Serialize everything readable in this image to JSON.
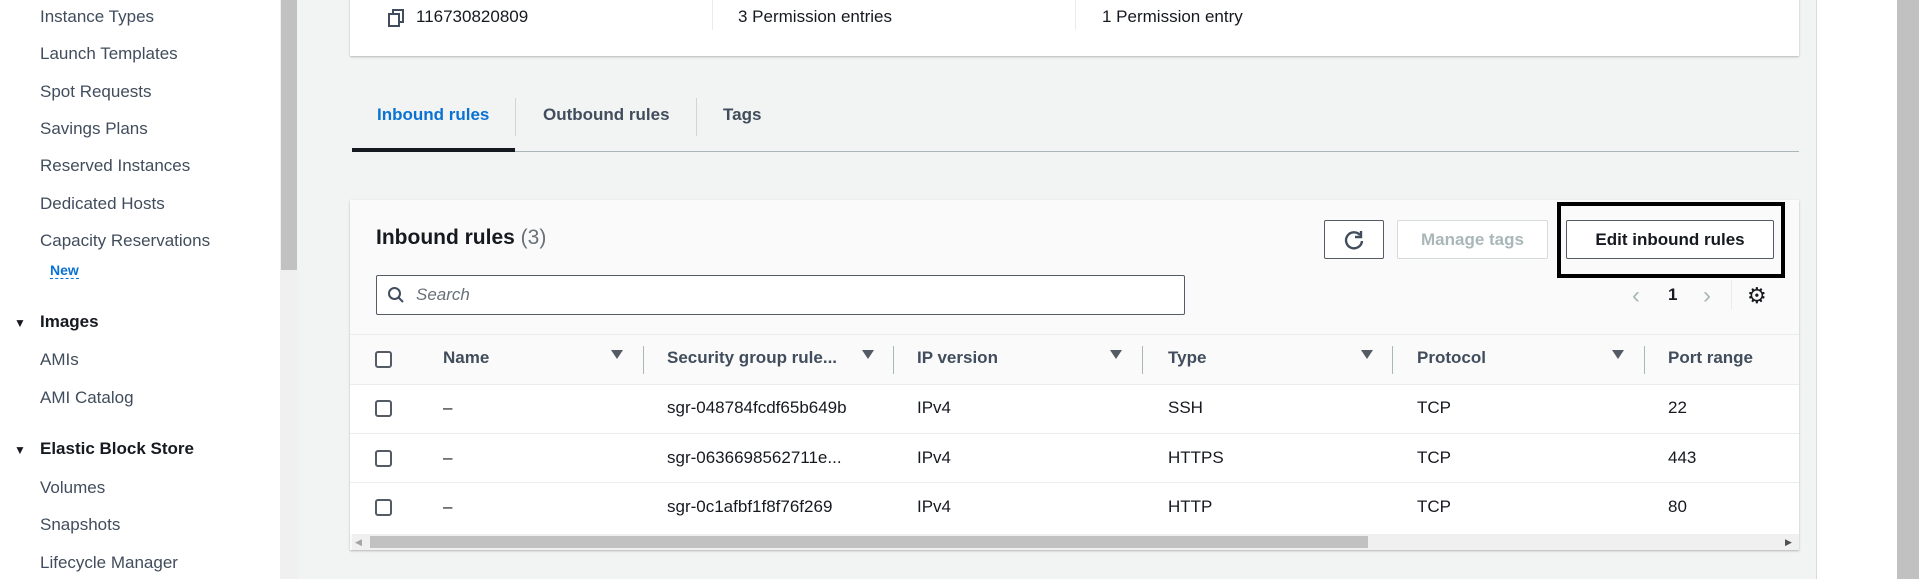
{
  "sidebar": {
    "items": [
      "Instance Types",
      "Launch Templates",
      "Spot Requests",
      "Savings Plans",
      "Reserved Instances",
      "Dedicated Hosts",
      "Capacity Reservations"
    ],
    "new_badge": "New",
    "images": {
      "heading": "Images",
      "items": [
        "AMIs",
        "AMI Catalog"
      ]
    },
    "ebs": {
      "heading": "Elastic Block Store",
      "items": [
        "Volumes",
        "Snapshots",
        "Lifecycle Manager"
      ]
    }
  },
  "summary": {
    "owner_id": "116730820809",
    "inbound_count": "3 Permission entries",
    "outbound_count": "1 Permission entry"
  },
  "tabs": [
    {
      "label": "Inbound rules",
      "active": true
    },
    {
      "label": "Outbound rules",
      "active": false
    },
    {
      "label": "Tags",
      "active": false
    }
  ],
  "table": {
    "title": "Inbound rules",
    "count": "(3)",
    "manage_tags": "Manage tags",
    "edit_rules": "Edit inbound rules",
    "search_placeholder": "Search",
    "page": "1",
    "columns": [
      "Name",
      "Security group rule...",
      "IP version",
      "Type",
      "Protocol",
      "Port range"
    ],
    "rows": [
      [
        "–",
        "sgr-048784fcdf65b649b",
        "IPv4",
        "SSH",
        "TCP",
        "22"
      ],
      [
        "–",
        "sgr-0636698562711e...",
        "IPv4",
        "HTTPS",
        "TCP",
        "443"
      ],
      [
        "–",
        "sgr-0c1afbf1f8f76f269",
        "IPv4",
        "HTTP",
        "TCP",
        "80"
      ]
    ]
  },
  "colors": {
    "accent": "#0972d3",
    "highlight_box": "#000000"
  }
}
